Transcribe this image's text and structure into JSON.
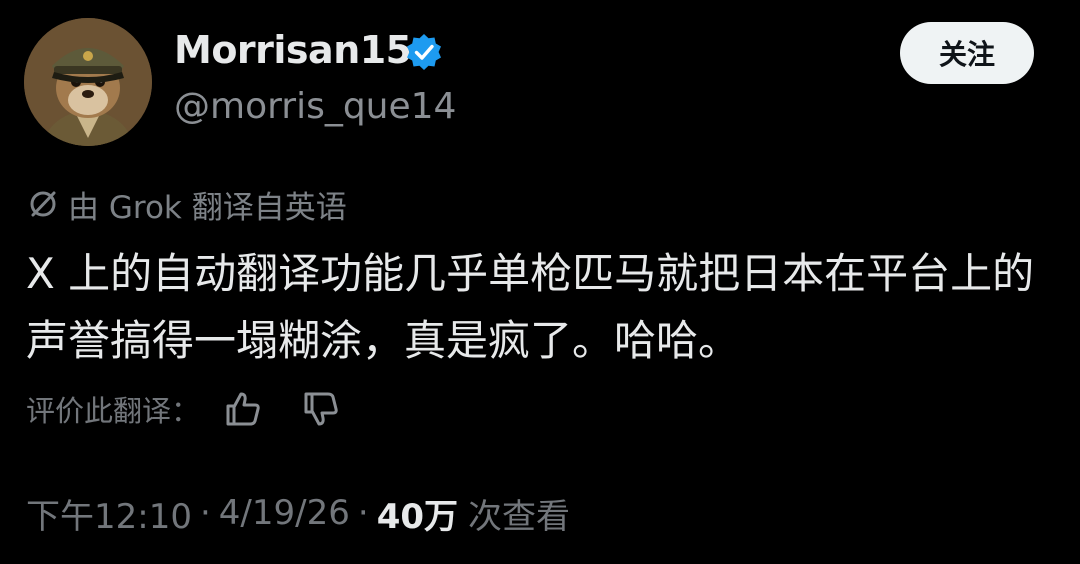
{
  "post": {
    "author": {
      "display_name": "Morrisan15",
      "handle": "@morris_que14",
      "verified": true,
      "avatar_icon": "marmot-avatar-icon"
    },
    "follow_label": "关注",
    "translation_note": "由 Grok 翻译自英语",
    "text": "X 上的自动翻译功能几乎单枪匹马就把日本在平台上的声誉搞得一塌糊涂，真是疯了。哈哈。",
    "rate_label": "评价此翻译：",
    "rate_icons": [
      "thumbs-up-icon",
      "thumbs-down-icon"
    ],
    "time": "下午12:10",
    "separator": "·",
    "date": "4/19/26",
    "views_count": "40万",
    "views_label": "次查看"
  },
  "colors": {
    "background": "#000000",
    "primary_text": "#e7e9ea",
    "secondary_text": "#72767b",
    "verified_blue": "#1d9bf0",
    "follow_button_bg": "#eff3f4"
  }
}
